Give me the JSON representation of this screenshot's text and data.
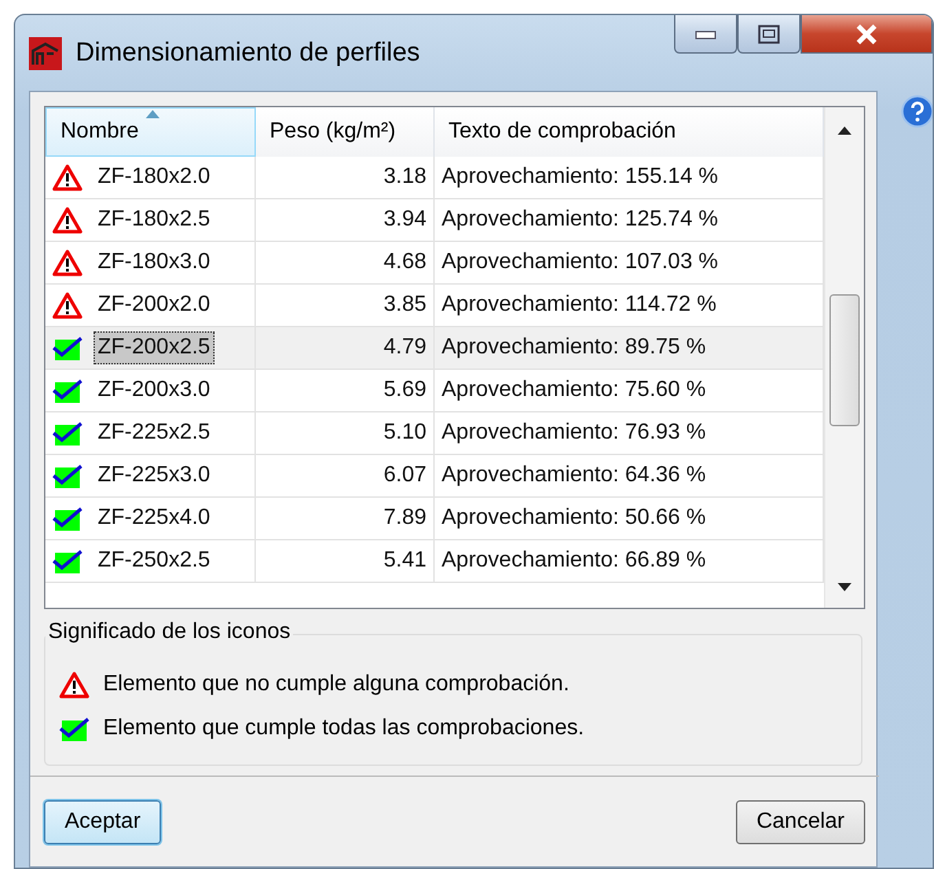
{
  "window": {
    "title": "Dimensionamiento de perfiles"
  },
  "table": {
    "columns": [
      {
        "label": "Nombre",
        "sorted": true
      },
      {
        "label": "Peso (kg/m²)",
        "sorted": false
      },
      {
        "label": "Texto de comprobación",
        "sorted": false
      }
    ],
    "rows": [
      {
        "kind": "fail",
        "name": "ZF-180x2.0",
        "weight": "3.18",
        "text": "Aprovechamiento: 155.14 %",
        "selected": false
      },
      {
        "kind": "fail",
        "name": "ZF-180x2.5",
        "weight": "3.94",
        "text": "Aprovechamiento: 125.74 %",
        "selected": false
      },
      {
        "kind": "fail",
        "name": "ZF-180x3.0",
        "weight": "4.68",
        "text": "Aprovechamiento: 107.03 %",
        "selected": false
      },
      {
        "kind": "fail",
        "name": "ZF-200x2.0",
        "weight": "3.85",
        "text": "Aprovechamiento: 114.72 %",
        "selected": false
      },
      {
        "kind": "pass",
        "name": "ZF-200x2.5",
        "weight": "4.79",
        "text": "Aprovechamiento: 89.75 %",
        "selected": true
      },
      {
        "kind": "pass",
        "name": "ZF-200x3.0",
        "weight": "5.69",
        "text": "Aprovechamiento: 75.60 %",
        "selected": false
      },
      {
        "kind": "pass",
        "name": "ZF-225x2.5",
        "weight": "5.10",
        "text": "Aprovechamiento: 76.93 %",
        "selected": false
      },
      {
        "kind": "pass",
        "name": "ZF-225x3.0",
        "weight": "6.07",
        "text": "Aprovechamiento: 64.36 %",
        "selected": false
      },
      {
        "kind": "pass",
        "name": "ZF-225x4.0",
        "weight": "7.89",
        "text": "Aprovechamiento: 50.66 %",
        "selected": false
      },
      {
        "kind": "pass",
        "name": "ZF-250x2.5",
        "weight": "5.41",
        "text": "Aprovechamiento: 66.89 %",
        "selected": false
      }
    ]
  },
  "legend": {
    "title": "Significado de los iconos",
    "items": [
      {
        "kind": "fail",
        "text": "Elemento que no cumple alguna comprobación."
      },
      {
        "kind": "pass",
        "text": "Elemento que cumple todas las comprobaciones."
      }
    ]
  },
  "buttons": [
    {
      "label": "Aceptar",
      "default": true
    },
    {
      "label": "Cancelar",
      "default": false
    }
  ]
}
